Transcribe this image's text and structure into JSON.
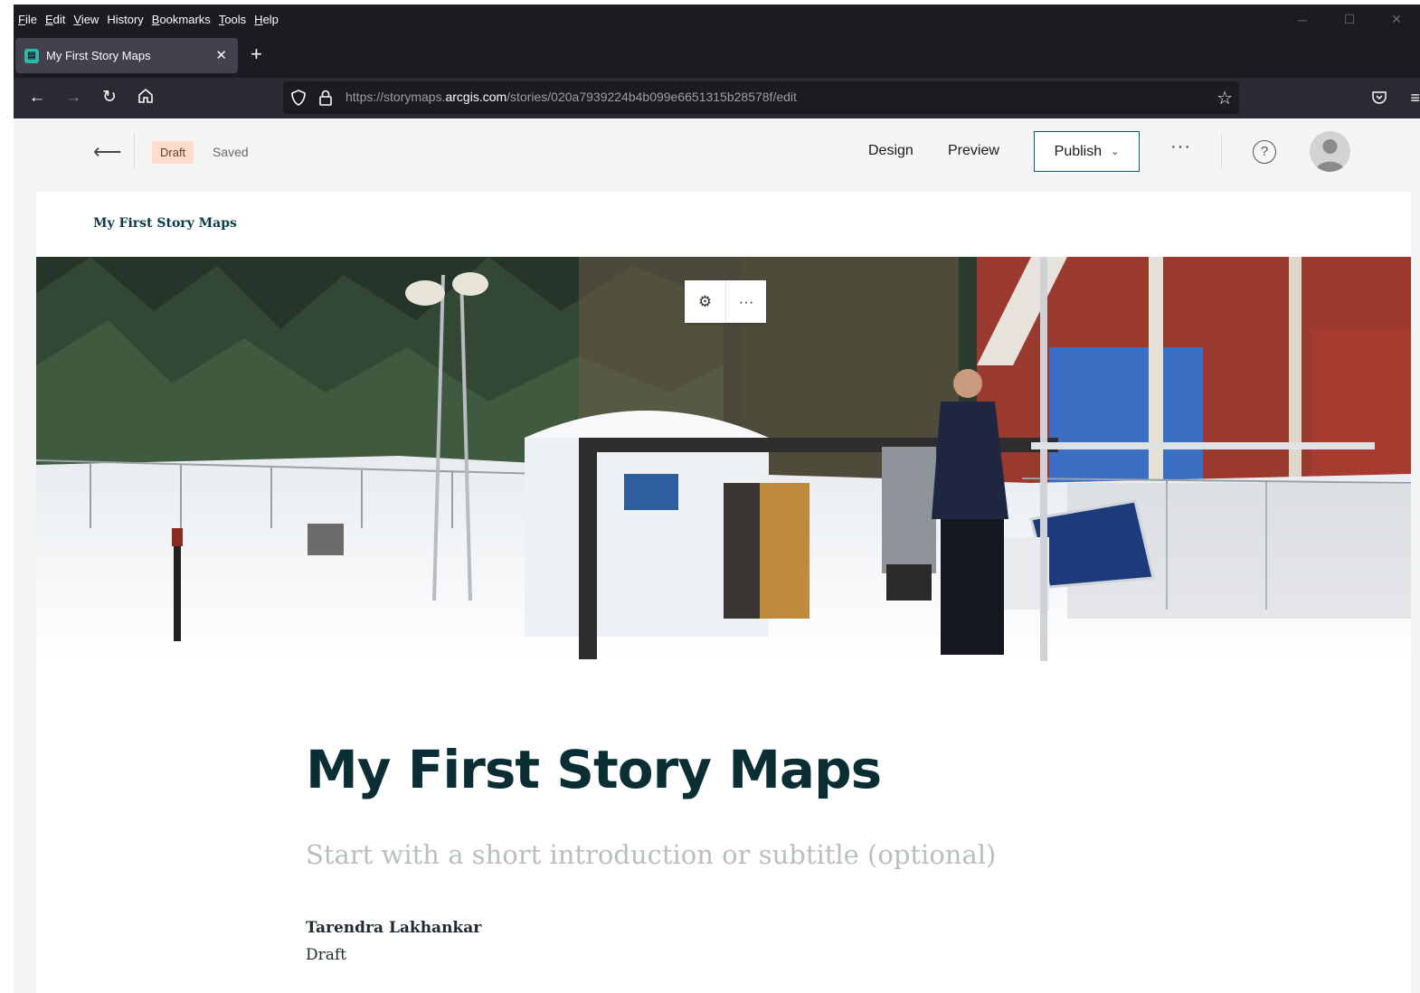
{
  "browser": {
    "menu": [
      {
        "accel": "F",
        "rest": "ile"
      },
      {
        "accel": "E",
        "rest": "dit"
      },
      {
        "accel": "V",
        "rest": "iew"
      },
      {
        "accel": "",
        "rest": "History"
      },
      {
        "accel": "B",
        "rest": "ookmarks"
      },
      {
        "accel": "T",
        "rest": "ools"
      },
      {
        "accel": "H",
        "rest": "elp"
      }
    ],
    "tab_title": "My First Story Maps",
    "url_prefix": "https://storymaps.",
    "url_domain": "arcgis.com",
    "url_path": "/stories/020a7939224b4b099e6651315b28578f/edit"
  },
  "app_header": {
    "draft_badge": "Draft",
    "saved_label": "Saved",
    "design_label": "Design",
    "preview_label": "Preview",
    "publish_label": "Publish",
    "more_label": "···",
    "help_label": "?"
  },
  "story": {
    "nav_title": "My First Story Maps",
    "title": "My First Story Maps",
    "subtitle_placeholder": "Start with a short introduction or subtitle (optional)",
    "author": "Tarendra Lakhankar",
    "status": "Draft"
  },
  "colors": {
    "browser_chrome": "#1c1b22",
    "accent_teal": "#0b5c6c",
    "draft_badge_bg": "#ffdccd",
    "title_color": "#0b2e35"
  }
}
